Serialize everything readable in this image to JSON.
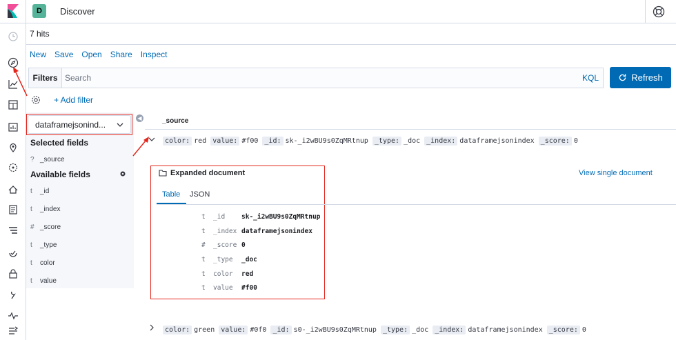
{
  "header": {
    "space_initial": "D",
    "app_title": "Discover"
  },
  "hits": "7 hits",
  "menu": [
    "New",
    "Save",
    "Open",
    "Share",
    "Inspect"
  ],
  "query": {
    "filters_label": "Filters",
    "search_placeholder": "Search",
    "language": "KQL",
    "refresh_label": "Refresh"
  },
  "add_filter": "+ Add filter",
  "sidebar": {
    "index_pattern": "dataframejsonind...",
    "selected_title": "Selected fields",
    "selected_fields": [
      {
        "type": "?",
        "name": "_source"
      }
    ],
    "available_title": "Available fields",
    "available_fields": [
      {
        "type": "t",
        "name": "_id"
      },
      {
        "type": "t",
        "name": "_index"
      },
      {
        "type": "#",
        "name": "_score"
      },
      {
        "type": "t",
        "name": "_type"
      },
      {
        "type": "t",
        "name": "color"
      },
      {
        "type": "t",
        "name": "value"
      }
    ]
  },
  "table": {
    "source_header": "_source",
    "rows": [
      [
        {
          "key": "color:",
          "val": "red"
        },
        {
          "key": "value:",
          "val": "#f00"
        },
        {
          "key": "_id:",
          "val": "sk-_i2wBU9s0ZqMRtnup"
        },
        {
          "key": "_type:",
          "val": "_doc"
        },
        {
          "key": "_index:",
          "val": "dataframejsonindex"
        },
        {
          "key": "_score:",
          "val": "0"
        }
      ],
      [
        {
          "key": "color:",
          "val": "green"
        },
        {
          "key": "value:",
          "val": "#0f0"
        },
        {
          "key": "_id:",
          "val": "s0-_i2wBU9s0ZqMRtnup"
        },
        {
          "key": "_type:",
          "val": "_doc"
        },
        {
          "key": "_index:",
          "val": "dataframejsonindex"
        },
        {
          "key": "_score:",
          "val": "0"
        }
      ]
    ]
  },
  "expanded": {
    "title": "Expanded document",
    "view_single": "View single document",
    "tabs": [
      "Table",
      "JSON"
    ],
    "fields": [
      {
        "type": "t",
        "field": "_id",
        "value": "sk-_i2wBU9s0ZqMRtnup"
      },
      {
        "type": "t",
        "field": "_index",
        "value": "dataframejsonindex"
      },
      {
        "type": "#",
        "field": "_score",
        "value": "0"
      },
      {
        "type": "t",
        "field": "_type",
        "value": "_doc"
      },
      {
        "type": "t",
        "field": "color",
        "value": "red"
      },
      {
        "type": "t",
        "field": "value",
        "value": "#f00"
      }
    ]
  },
  "colors": {
    "accent": "#006bb4",
    "annotation": "#e3261c",
    "sidebar_bg": "#f5f7fa"
  },
  "nav_icons": [
    "clock-icon",
    "compass-icon",
    "visualize-icon",
    "dashboard-icon",
    "canvas-icon",
    "maps-icon",
    "ml-icon",
    "infrastructure-icon",
    "logs-icon",
    "apm-icon",
    "uptime-icon",
    "siem-icon",
    "dev-tools-icon",
    "monitoring-icon",
    "management-icon"
  ]
}
